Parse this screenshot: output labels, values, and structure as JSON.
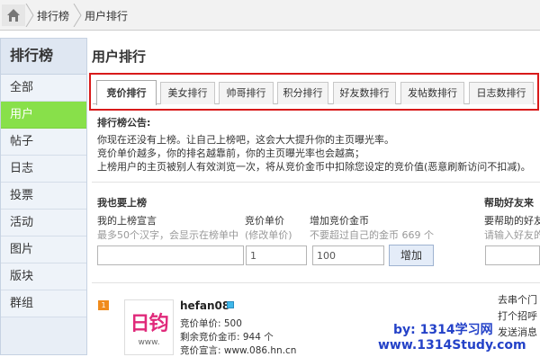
{
  "breadcrumb": {
    "items": [
      "排行榜",
      "用户排行"
    ]
  },
  "sidebar": {
    "title": "排行榜",
    "items": [
      {
        "label": "全部",
        "active": false
      },
      {
        "label": "用户",
        "active": true
      },
      {
        "label": "帖子",
        "active": false
      },
      {
        "label": "日志",
        "active": false
      },
      {
        "label": "投票",
        "active": false
      },
      {
        "label": "活动",
        "active": false
      },
      {
        "label": "图片",
        "active": false
      },
      {
        "label": "版块",
        "active": false
      },
      {
        "label": "群组",
        "active": false
      }
    ]
  },
  "page": {
    "title": "用户排行"
  },
  "tabs": [
    {
      "label": "竞价排行",
      "active": true
    },
    {
      "label": "美女排行",
      "active": false
    },
    {
      "label": "帅哥排行",
      "active": false
    },
    {
      "label": "积分排行",
      "active": false
    },
    {
      "label": "好友数排行",
      "active": false
    },
    {
      "label": "发帖数排行",
      "active": false
    },
    {
      "label": "日志数排行",
      "active": false
    }
  ],
  "notice": {
    "heading": "排行榜公告:",
    "lines": [
      "你现在还没有上榜。让自己上榜吧，这会大大提升你的主页曝光率。",
      "竞价单价越多，你的排名越靠前，你的主页曝光率也会越高；",
      "上榜用户的主页被别人有效浏览一次，将从竞价金币中扣除您设定的竞价值(恶意刷新访问不扣减)。"
    ]
  },
  "form": {
    "section_title": "我也要上榜",
    "declaration_label": "我的上榜宣言",
    "declaration_hint": "最多50个汉字，会显示在榜单中",
    "declaration_value": "",
    "price_label": "竞价单价",
    "price_hint": "(修改单价)",
    "price_value": "1",
    "coins_label": "增加竞价金币",
    "coins_hint": "不要超过自己的金币 669 个",
    "coins_value": "100",
    "submit_label": "增加"
  },
  "help": {
    "title": "帮助好友来",
    "label": "要帮助的好友",
    "placeholder": "请输入好友的"
  },
  "ranking": {
    "rank": "1",
    "username": "hefan08",
    "avatar_text": "日钧",
    "avatar_url_text": "www.",
    "price": "竞价单价: 500",
    "remaining": "剩余竞价金币: 944 个",
    "declaration": "竞价宣言: www.086.hn.cn"
  },
  "right_panel": [
    "去串个门",
    "打个招呼",
    "发送消息"
  ],
  "watermark": {
    "line1": "by: 1314学习网",
    "line2": "www.1314Study.com"
  },
  "colors": {
    "active_tab_border": "#d81a1a",
    "sidebar_active": "#88e04a",
    "online_badge": "#3fb8ea",
    "watermark": "#2442c8"
  }
}
